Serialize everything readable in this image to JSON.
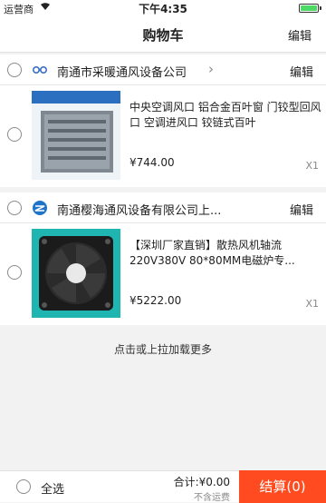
{
  "status_bar": {
    "carrier": "运营商",
    "time": "下午4:35"
  },
  "nav": {
    "title": "购物车",
    "edit_label": "编辑"
  },
  "shops": [
    {
      "name": "南通市采暖通风设备公司",
      "edit_label": "编辑",
      "item": {
        "title": "中央空调风口 铝合金百叶窗 门铰型回风口 空调进风口 铰链式百叶",
        "price": "¥744.00",
        "qty": "X1"
      }
    },
    {
      "name": "南通樱海通风设备有限公司上...",
      "edit_label": "编辑",
      "item": {
        "title": "【深圳厂家直销】散热风机轴流220V380V 80*80MM电磁炉专...",
        "price": "¥5222.00",
        "qty": "X1"
      }
    }
  ],
  "load_more": "点击或上拉加载更多",
  "footer": {
    "select_all_label": "全选",
    "total_label": "合计:¥0.00",
    "shipping_note": "不含运费",
    "checkout_label": "结算(0)"
  },
  "colors": {
    "accent": "#ff4b1f",
    "battery": "#4cd964"
  },
  "icons": [
    "wifi-icon",
    "battery-icon",
    "chevron-right-icon",
    "shop-logo-icon"
  ]
}
